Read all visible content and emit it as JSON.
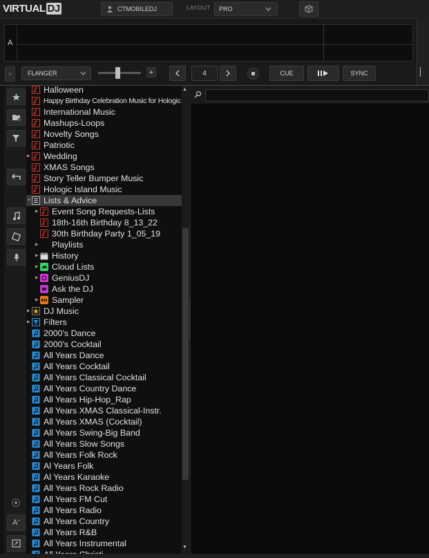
{
  "app": {
    "logo_part1": "VIRTUAL",
    "logo_part2": "DJ",
    "user": "CTMOBILEDJ",
    "layout_label": "LAYOUT",
    "layout_value": "PRO"
  },
  "deck": {
    "label": "A",
    "effect": "FLANGER",
    "loop_size": "4",
    "cue_label": "CUE",
    "sync_label": "SYNC",
    "expand_label": ">"
  },
  "browser": {
    "folders_tab_label": "folders",
    "search_placeholder": "",
    "tree": [
      {
        "label": "Halloween",
        "type": "red",
        "indent": 0,
        "arrow": false
      },
      {
        "label": "Happy Birthday Celebration Music for Hologic",
        "type": "red",
        "indent": 0,
        "arrow": false,
        "condensed": true
      },
      {
        "label": "International Music",
        "type": "red",
        "indent": 0,
        "arrow": false
      },
      {
        "label": "Mashups-Loops",
        "type": "red",
        "indent": 0,
        "arrow": false
      },
      {
        "label": "Novelty Songs",
        "type": "red",
        "indent": 0,
        "arrow": false
      },
      {
        "label": "Patriotic",
        "type": "red",
        "indent": 0,
        "arrow": false
      },
      {
        "label": "Wedding",
        "type": "red",
        "indent": 0,
        "arrow": true
      },
      {
        "label": "XMAS Songs",
        "type": "red",
        "indent": 0,
        "arrow": false
      },
      {
        "label": "Story Teller Bumper Music",
        "type": "red",
        "indent": 0,
        "arrow": false
      },
      {
        "label": "Hologic Island Music",
        "type": "red",
        "indent": 0,
        "arrow": false
      },
      {
        "label": "Lists & Advice",
        "type": "list",
        "indent": 0,
        "arrow": true,
        "selected": true
      },
      {
        "label": "Event Song Requests-Lists",
        "type": "red",
        "indent": 1,
        "arrow": true
      },
      {
        "label": "18th-16th Birthday 8_13_22",
        "type": "red",
        "indent": 1,
        "arrow": false
      },
      {
        "label": "30th Birthday Party 1_05_19",
        "type": "red",
        "indent": 1,
        "arrow": false
      },
      {
        "label": "Playlists",
        "type": "none",
        "indent": 1,
        "arrow": true
      },
      {
        "label": "History",
        "type": "history",
        "indent": 1,
        "arrow": true
      },
      {
        "label": "Cloud Lists",
        "type": "cloud",
        "indent": 1,
        "arrow": true
      },
      {
        "label": "GeniusDJ",
        "type": "genius",
        "indent": 1,
        "arrow": true
      },
      {
        "label": "Ask the DJ",
        "type": "ask",
        "indent": 1,
        "arrow": false
      },
      {
        "label": "Sampler",
        "type": "sampler",
        "indent": 1,
        "arrow": true
      },
      {
        "label": "DJ Music",
        "type": "star",
        "indent": 0,
        "arrow": true
      },
      {
        "label": "Filters",
        "type": "filter",
        "indent": 0,
        "arrow": true
      },
      {
        "label": "2000's Dance",
        "type": "blue",
        "indent": 0,
        "arrow": false
      },
      {
        "label": "2000's Cocktail",
        "type": "blue",
        "indent": 0,
        "arrow": false
      },
      {
        "label": "All Years Dance",
        "type": "blue",
        "indent": 0,
        "arrow": false
      },
      {
        "label": "All Years Cocktail",
        "type": "blue",
        "indent": 0,
        "arrow": false
      },
      {
        "label": "All Years Classical Cocktail",
        "type": "blue",
        "indent": 0,
        "arrow": false
      },
      {
        "label": "All Years Country Dance",
        "type": "blue",
        "indent": 0,
        "arrow": false
      },
      {
        "label": "All Years Hip-Hop_Rap",
        "type": "blue",
        "indent": 0,
        "arrow": false
      },
      {
        "label": "All Years XMAS Classical-Instr.",
        "type": "blue",
        "indent": 0,
        "arrow": false
      },
      {
        "label": "All Years XMAS (Cocktail)",
        "type": "blue",
        "indent": 0,
        "arrow": false
      },
      {
        "label": "All Years Swing-Big Band",
        "type": "blue",
        "indent": 0,
        "arrow": false
      },
      {
        "label": "All Years Slow Songs",
        "type": "blue",
        "indent": 0,
        "arrow": false
      },
      {
        "label": "All Years Folk Rock",
        "type": "blue",
        "indent": 0,
        "arrow": false
      },
      {
        "label": "Al Years Folk",
        "type": "blue",
        "indent": 0,
        "arrow": false
      },
      {
        "label": "Al Years Karaoke",
        "type": "blue",
        "indent": 0,
        "arrow": false
      },
      {
        "label": "All Years Rock Radio",
        "type": "blue",
        "indent": 0,
        "arrow": false
      },
      {
        "label": "All Years FM Cut",
        "type": "blue",
        "indent": 0,
        "arrow": false
      },
      {
        "label": "All Years Radio",
        "type": "blue",
        "indent": 0,
        "arrow": false
      },
      {
        "label": "All Years Country",
        "type": "blue",
        "indent": 0,
        "arrow": false
      },
      {
        "label": "All Years R&B",
        "type": "blue",
        "indent": 0,
        "arrow": false
      },
      {
        "label": "All Years Instrumental",
        "type": "blue",
        "indent": 0,
        "arrow": false
      },
      {
        "label": "All Years Christi",
        "type": "blue",
        "indent": 0,
        "arrow": false
      }
    ]
  },
  "colors": {
    "red_folder": "#c0392b",
    "blue_folder": "#2f8fd8",
    "cloud": "#3ecf6a",
    "genius": "#d63ad6",
    "ask": "#c03ad0",
    "sampler": "#e07a1a",
    "star": "#e0b020"
  }
}
